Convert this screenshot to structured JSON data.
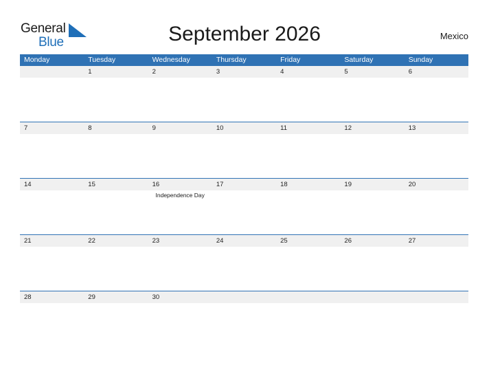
{
  "brand": {
    "name_part1": "General",
    "name_part2": "Blue",
    "flag_icon": "flag-triangle-icon",
    "accent_color": "#1f6fb8"
  },
  "header": {
    "title": "September 2026",
    "country": "Mexico"
  },
  "colors": {
    "header_blue": "#2f72b4",
    "date_band_gray": "#f0f0f0",
    "rule_blue": "#2f72b4",
    "text_dark": "#1a1a1a"
  },
  "calendar": {
    "weekdays": [
      "Monday",
      "Tuesday",
      "Wednesday",
      "Thursday",
      "Friday",
      "Saturday",
      "Sunday"
    ],
    "weeks": [
      [
        {
          "date": "",
          "events": []
        },
        {
          "date": "1",
          "events": []
        },
        {
          "date": "2",
          "events": []
        },
        {
          "date": "3",
          "events": []
        },
        {
          "date": "4",
          "events": []
        },
        {
          "date": "5",
          "events": []
        },
        {
          "date": "6",
          "events": []
        }
      ],
      [
        {
          "date": "7",
          "events": []
        },
        {
          "date": "8",
          "events": []
        },
        {
          "date": "9",
          "events": []
        },
        {
          "date": "10",
          "events": []
        },
        {
          "date": "11",
          "events": []
        },
        {
          "date": "12",
          "events": []
        },
        {
          "date": "13",
          "events": []
        }
      ],
      [
        {
          "date": "14",
          "events": []
        },
        {
          "date": "15",
          "events": []
        },
        {
          "date": "16",
          "events": [
            "Independence Day"
          ]
        },
        {
          "date": "17",
          "events": []
        },
        {
          "date": "18",
          "events": []
        },
        {
          "date": "19",
          "events": []
        },
        {
          "date": "20",
          "events": []
        }
      ],
      [
        {
          "date": "21",
          "events": []
        },
        {
          "date": "22",
          "events": []
        },
        {
          "date": "23",
          "events": []
        },
        {
          "date": "24",
          "events": []
        },
        {
          "date": "25",
          "events": []
        },
        {
          "date": "26",
          "events": []
        },
        {
          "date": "27",
          "events": []
        }
      ],
      [
        {
          "date": "28",
          "events": []
        },
        {
          "date": "29",
          "events": []
        },
        {
          "date": "30",
          "events": []
        },
        {
          "date": "",
          "events": []
        },
        {
          "date": "",
          "events": []
        },
        {
          "date": "",
          "events": []
        },
        {
          "date": "",
          "events": []
        }
      ]
    ]
  }
}
